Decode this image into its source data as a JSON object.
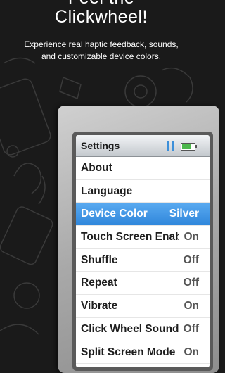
{
  "promo": {
    "headline_line1": "Feel the",
    "headline_line2": "Clickwheel!",
    "subtitle_line1": "Experience real haptic feedback, sounds,",
    "subtitle_line2": "and customizable device colors."
  },
  "screen": {
    "title": "Settings",
    "battery_level": 0.8,
    "status_icons": [
      "pause-icon",
      "battery-icon"
    ],
    "menu": [
      {
        "label": "About",
        "value": ""
      },
      {
        "label": "Language",
        "value": ""
      },
      {
        "label": "Device Color",
        "value": "Silver",
        "selected": true
      },
      {
        "label": "Touch Screen Enabled",
        "value": "On"
      },
      {
        "label": "Shuffle",
        "value": "Off"
      },
      {
        "label": "Repeat",
        "value": "Off"
      },
      {
        "label": "Vibrate",
        "value": "On"
      },
      {
        "label": "Click Wheel Sounds",
        "value": "Off"
      },
      {
        "label": "Split Screen Mode",
        "value": "On"
      }
    ]
  },
  "colors": {
    "background": "#1a1a1a",
    "selection": "#3a8fe0",
    "device_body": "#b5b5b5"
  }
}
